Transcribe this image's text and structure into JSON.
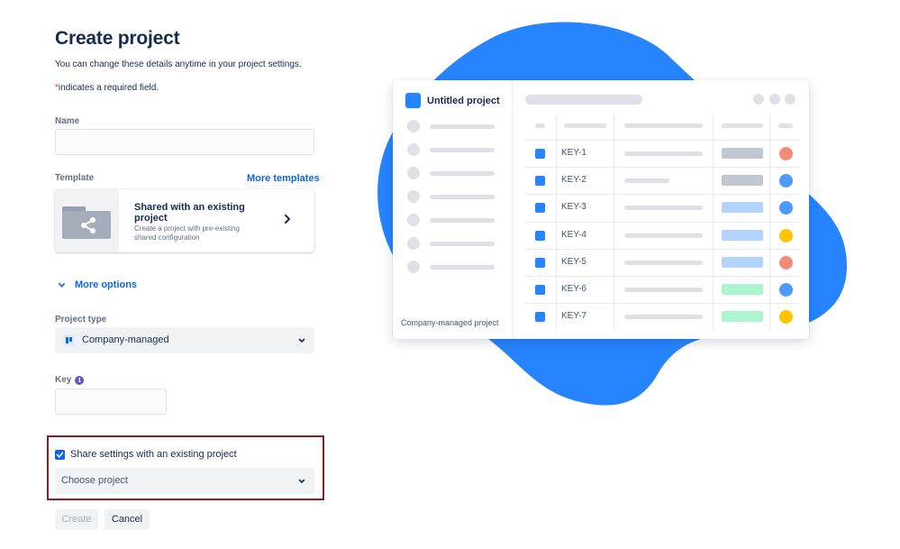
{
  "form": {
    "title": "Create project",
    "subtitle": "You can change these details anytime in your project settings.",
    "required_star": "*",
    "required_text": "indicates a required field.",
    "name": {
      "label": "Name",
      "value": "",
      "placeholder": ""
    },
    "template": {
      "label": "Template",
      "more_link": "More templates",
      "card_title": "Shared with an existing project",
      "card_description": "Create a project with pre-existing shared configuration",
      "thumb_icon": "share-folder-icon",
      "chevron_icon": "chevron-right-icon"
    },
    "more_options": "More options",
    "project_type": {
      "label": "Project type",
      "value": "Company-managed",
      "icon": "company-managed-icon"
    },
    "key": {
      "label": "Key",
      "info_icon": "i",
      "value": ""
    },
    "share_settings": {
      "checked": true,
      "label": "Share settings with an existing project",
      "select_placeholder": "Choose project"
    },
    "buttons": {
      "create": "Create",
      "cancel": "Cancel"
    }
  },
  "preview": {
    "project_name": "Untitled project",
    "footer": "Company-managed project",
    "rows": [
      {
        "key": "KEY-1",
        "status_color": "#c1c7d0",
        "dot_color": "#f38b77"
      },
      {
        "key": "KEY-2",
        "status_color": "#c1c7d0",
        "dot_color": "#4c9aff"
      },
      {
        "key": "KEY-3",
        "status_color": "#b3d4ff",
        "dot_color": "#4c9aff"
      },
      {
        "key": "KEY-4",
        "status_color": "#b3d4ff",
        "dot_color": "#ffc400"
      },
      {
        "key": "KEY-5",
        "status_color": "#b3d4ff",
        "dot_color": "#f38b77"
      },
      {
        "key": "KEY-6",
        "status_color": "#abf5d1",
        "dot_color": "#4c9aff"
      },
      {
        "key": "KEY-7",
        "status_color": "#abf5d1",
        "dot_color": "#ffc400"
      }
    ]
  },
  "colors": {
    "accent": "#0c66e4",
    "blob": "#2684ff",
    "highlight_border": "#8b1e1e"
  }
}
